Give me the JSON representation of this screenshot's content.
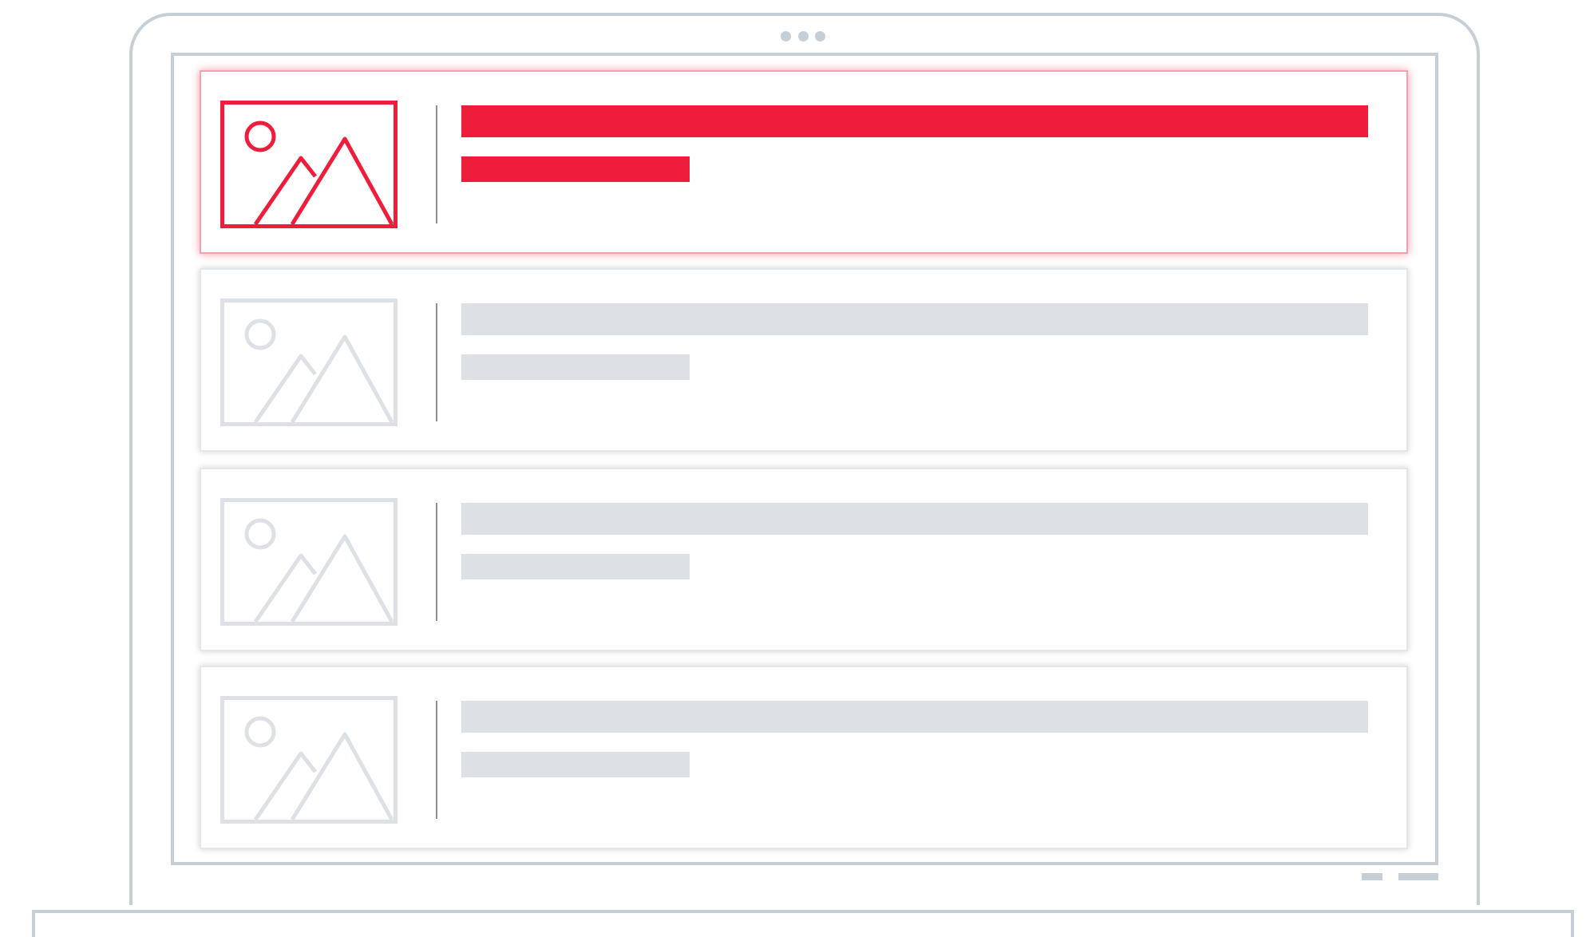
{
  "colors": {
    "accent": "#f01c3c",
    "placeholder": "#dde1e5",
    "frame": "#c7cfd6",
    "divider": "#8c8f93"
  },
  "device": {
    "type": "laptop",
    "camera_dot_count": 3,
    "indicator_count": 2
  },
  "list": {
    "items": [
      {
        "state": "selected",
        "icon": "image-icon",
        "color": "#f01c3c"
      },
      {
        "state": "placeholder",
        "icon": "image-icon",
        "color": "#dde1e5"
      },
      {
        "state": "placeholder",
        "icon": "image-icon",
        "color": "#dde1e5"
      },
      {
        "state": "placeholder",
        "icon": "image-icon",
        "color": "#dde1e5"
      }
    ]
  }
}
